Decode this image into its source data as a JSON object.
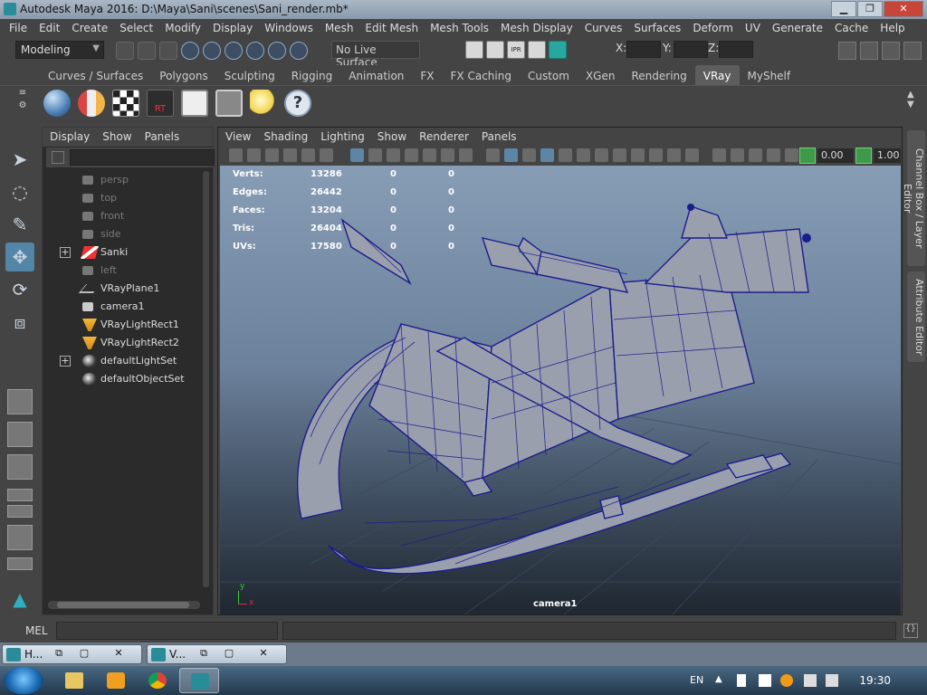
{
  "window": {
    "title": "Autodesk Maya 2016: D:\\Maya\\Sani\\scenes\\Sani_render.mb*"
  },
  "menubar": [
    "File",
    "Edit",
    "Create",
    "Select",
    "Modify",
    "Display",
    "Windows",
    "Mesh",
    "Edit Mesh",
    "Mesh Tools",
    "Mesh Display",
    "Curves",
    "Surfaces",
    "Deform",
    "UV",
    "Generate",
    "Cache",
    "Help"
  ],
  "statusline": {
    "mode": "Modeling",
    "live_surface": "No Live Surface",
    "ipr_label": "IPR",
    "x_label": "X:",
    "y_label": "Y:",
    "z_label": "Z:"
  },
  "shelf_tabs": [
    "Curves / Surfaces",
    "Polygons",
    "Sculpting",
    "Rigging",
    "Animation",
    "FX",
    "FX Caching",
    "Custom",
    "XGen",
    "Rendering",
    "VRay",
    "MyShelf"
  ],
  "shelf_active_tab": "VRay",
  "shelf_icons": [
    "vray-sphere-icon",
    "vray-material-icon",
    "checker-icon",
    "rt-render-icon",
    "frame-buffer-icon",
    "render-settings-icon",
    "light-bulb-icon",
    "help-icon"
  ],
  "shelf_rt_label": "RT",
  "shelf_help_label": "?",
  "outliner": {
    "menu": [
      "Display",
      "Show",
      "Panels"
    ],
    "items": [
      {
        "label": "persp",
        "icon": "camera-icon",
        "dim": true,
        "expand": false
      },
      {
        "label": "top",
        "icon": "camera-icon",
        "dim": true,
        "expand": false
      },
      {
        "label": "front",
        "icon": "camera-icon",
        "dim": true,
        "expand": false
      },
      {
        "label": "side",
        "icon": "camera-icon",
        "dim": true,
        "expand": false
      },
      {
        "label": "Sanki",
        "icon": "mesh-icon",
        "dim": false,
        "expand": true
      },
      {
        "label": "left",
        "icon": "camera-icon",
        "dim": true,
        "expand": false
      },
      {
        "label": "VRayPlane1",
        "icon": "plane-icon",
        "dim": false,
        "expand": false
      },
      {
        "label": "camera1",
        "icon": "camera-icon",
        "dim": false,
        "expand": false
      },
      {
        "label": "VRayLightRect1",
        "icon": "rect-light-icon",
        "dim": false,
        "expand": false
      },
      {
        "label": "VRayLightRect2",
        "icon": "rect-light-icon",
        "dim": false,
        "expand": false
      },
      {
        "label": "defaultLightSet",
        "icon": "set-icon",
        "dim": false,
        "expand": true
      },
      {
        "label": "defaultObjectSet",
        "icon": "set-icon",
        "dim": false,
        "expand": false
      }
    ],
    "expand_symbol": "+"
  },
  "viewport": {
    "menu": [
      "View",
      "Shading",
      "Lighting",
      "Show",
      "Renderer",
      "Panels"
    ],
    "near_clip": "0.00",
    "far_value": "1.00",
    "hud": [
      {
        "label": "Verts:",
        "v1": "13286",
        "v2": "0",
        "v3": "0"
      },
      {
        "label": "Edges:",
        "v1": "26442",
        "v2": "0",
        "v3": "0"
      },
      {
        "label": "Faces:",
        "v1": "13204",
        "v2": "0",
        "v3": "0"
      },
      {
        "label": "Tris:",
        "v1": "26404",
        "v2": "0",
        "v3": "0"
      },
      {
        "label": "UVs:",
        "v1": "17580",
        "v2": "0",
        "v3": "0"
      }
    ],
    "camera_label": "camera1",
    "axis_y": "y",
    "axis_x": "x"
  },
  "right_dock": {
    "channel_box": "Channel Box / Layer Editor",
    "attribute_editor": "Attribute Editor"
  },
  "cmdline": {
    "label": "MEL"
  },
  "min_windows": [
    {
      "label": "H..."
    },
    {
      "label": "V..."
    }
  ],
  "min_btn_glyphs": {
    "restore": "⧉",
    "max": "▢",
    "close": "✕"
  },
  "taskbar": {
    "lang": "EN",
    "time": "19:30"
  },
  "colors": {
    "selection_blue": "#5285a6",
    "wire_blue": "#1a1d8c",
    "mesh_grey": "#9a9fae",
    "maya_teal": "#2a8c99"
  }
}
